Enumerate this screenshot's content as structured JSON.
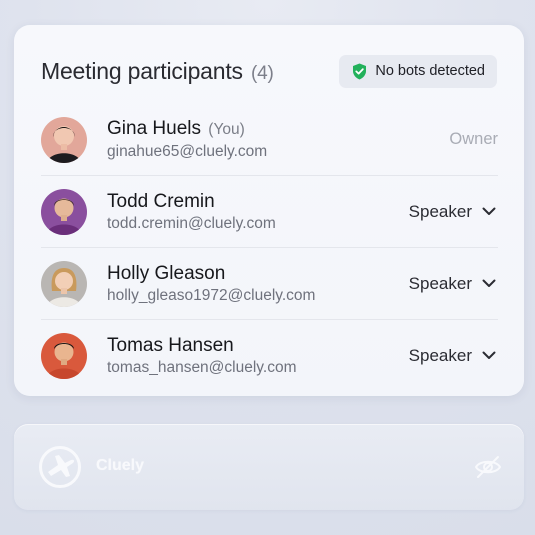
{
  "panel": {
    "title": "Meeting participants",
    "count": "(4)",
    "badge": {
      "label": "No bots detected",
      "icon": "shield-check-icon",
      "color": "#22b15b"
    }
  },
  "participants": [
    {
      "name": "Gina Huels",
      "you_tag": "(You)",
      "email": "ginahue65@cluely.com",
      "role": "Owner",
      "role_editable": false,
      "avatar": "avatar-gina"
    },
    {
      "name": "Todd Cremin",
      "email": "todd.cremin@cluely.com",
      "role": "Speaker",
      "role_editable": true,
      "avatar": "avatar-todd"
    },
    {
      "name": "Holly Gleason",
      "email": "holly_gleaso1972@cluely.com",
      "role": "Speaker",
      "role_editable": true,
      "avatar": "avatar-holly"
    },
    {
      "name": "Tomas Hansen",
      "email": "tomas_hansen@cluely.com",
      "role": "Speaker",
      "role_editable": true,
      "avatar": "avatar-tomas"
    }
  ],
  "bottom_bar": {
    "app_name": "Cluely",
    "logo_icon": "cluely-logo-icon",
    "hide_icon": "eye-off-icon"
  }
}
